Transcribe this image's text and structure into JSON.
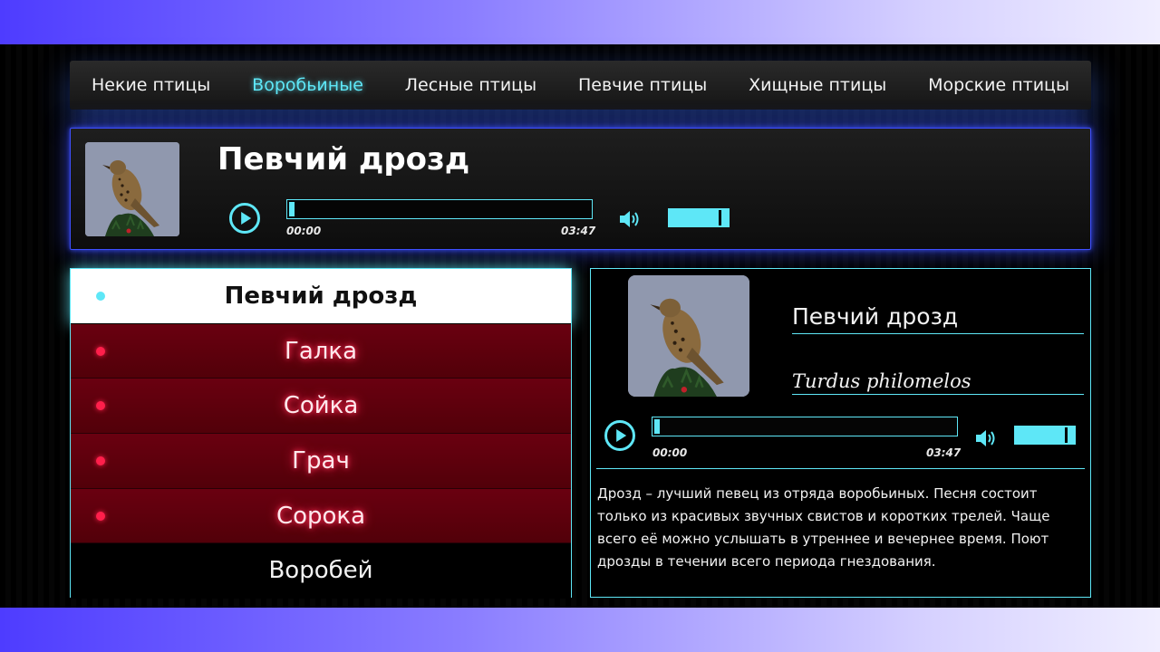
{
  "nav": {
    "items": [
      {
        "label": "Некие птицы",
        "active": false
      },
      {
        "label": "Воробьиные",
        "active": true
      },
      {
        "label": "Лесные птицы",
        "active": false
      },
      {
        "label": "Певчие птицы",
        "active": false
      },
      {
        "label": "Хищные птицы",
        "active": false
      },
      {
        "label": "Морские птицы",
        "active": false
      }
    ]
  },
  "player": {
    "title": "Певчий дрозд",
    "current_time": "00:00",
    "duration": "03:47",
    "progress": 0.0,
    "volume": 0.9
  },
  "list": {
    "items": [
      {
        "label": "Певчий дрозд",
        "state": "selected"
      },
      {
        "label": "Галка",
        "state": "red"
      },
      {
        "label": "Сойка",
        "state": "red"
      },
      {
        "label": "Грач",
        "state": "red"
      },
      {
        "label": "Сорока",
        "state": "red"
      },
      {
        "label": "Воробей",
        "state": "plain"
      }
    ]
  },
  "details": {
    "name": "Певчий дрозд",
    "latin": "Turdus philomelos",
    "current_time": "00:00",
    "duration": "03:47",
    "progress": 0.0,
    "volume": 0.9,
    "description": "Дрозд – лучший певец из отряда воробьиных. Песня состоит только из красивых звучных свистов и коротких трелей. Чаще всего её можно услышать в утреннее и вечернее время. Поют дрозды в течении всего периода гнездования."
  },
  "colors": {
    "accent": "#5ee7f7",
    "panel_border": "#3e4fff",
    "list_red": "#6a0010",
    "list_dot_red": "#ff1f4b"
  },
  "icons": [
    "play-icon",
    "volume-icon",
    "bird-photo"
  ]
}
